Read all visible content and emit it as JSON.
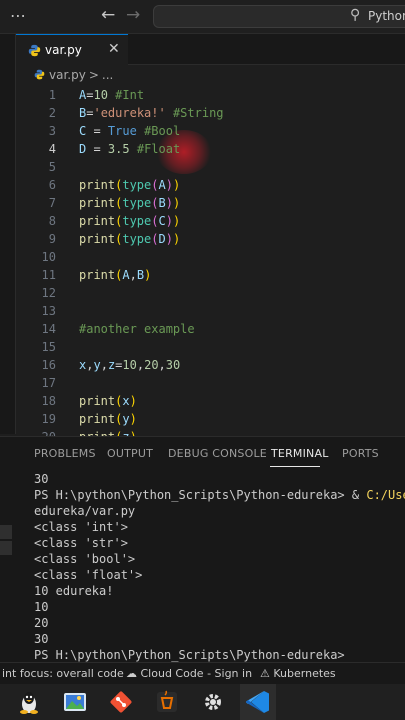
{
  "titlebar": {
    "search_text": "Python"
  },
  "tab": {
    "name": "var.py",
    "close": "✕"
  },
  "breadcrumb": {
    "file": "var.py",
    "sep": ">",
    "more": "..."
  },
  "editor": {
    "lines": [
      {
        "num": "1",
        "tokens": [
          [
            "v",
            "A"
          ],
          [
            "",
            "="
          ],
          [
            "n",
            "10"
          ],
          [
            "",
            " "
          ],
          [
            "c",
            "#Int"
          ]
        ]
      },
      {
        "num": "2",
        "tokens": [
          [
            "v",
            "B"
          ],
          [
            "",
            "="
          ],
          [
            "s",
            "'edureka!'"
          ],
          [
            "",
            " "
          ],
          [
            "c",
            "#String"
          ]
        ]
      },
      {
        "num": "3",
        "tokens": [
          [
            "v",
            "C"
          ],
          [
            "",
            " = "
          ],
          [
            "k",
            "True"
          ],
          [
            "",
            " "
          ],
          [
            "c",
            "#Bool"
          ]
        ]
      },
      {
        "num": "4",
        "tokens": [
          [
            "v",
            "D"
          ],
          [
            "",
            " = "
          ],
          [
            "n",
            "3.5"
          ],
          [
            "",
            " "
          ],
          [
            "c",
            "#Float"
          ]
        ]
      },
      {
        "num": "5",
        "tokens": []
      },
      {
        "num": "6",
        "tokens": [
          [
            "f",
            "print"
          ],
          [
            "p",
            "("
          ],
          [
            "t",
            "type"
          ],
          [
            "p2",
            "("
          ],
          [
            "v",
            "A"
          ],
          [
            "p2",
            ")"
          ],
          [
            "p",
            ")"
          ]
        ]
      },
      {
        "num": "7",
        "tokens": [
          [
            "f",
            "print"
          ],
          [
            "p",
            "("
          ],
          [
            "t",
            "type"
          ],
          [
            "p2",
            "("
          ],
          [
            "v",
            "B"
          ],
          [
            "p2",
            ")"
          ],
          [
            "p",
            ")"
          ]
        ]
      },
      {
        "num": "8",
        "tokens": [
          [
            "f",
            "print"
          ],
          [
            "p",
            "("
          ],
          [
            "t",
            "type"
          ],
          [
            "p2",
            "("
          ],
          [
            "v",
            "C"
          ],
          [
            "p2",
            ")"
          ],
          [
            "p",
            ")"
          ]
        ]
      },
      {
        "num": "9",
        "tokens": [
          [
            "f",
            "print"
          ],
          [
            "p",
            "("
          ],
          [
            "t",
            "type"
          ],
          [
            "p2",
            "("
          ],
          [
            "v",
            "D"
          ],
          [
            "p2",
            ")"
          ],
          [
            "p",
            ")"
          ]
        ]
      },
      {
        "num": "10",
        "tokens": []
      },
      {
        "num": "11",
        "tokens": [
          [
            "f",
            "print"
          ],
          [
            "p",
            "("
          ],
          [
            "v",
            "A"
          ],
          [
            "",
            ","
          ],
          [
            "v",
            "B"
          ],
          [
            "p",
            ")"
          ]
        ]
      },
      {
        "num": "12",
        "tokens": []
      },
      {
        "num": "13",
        "tokens": []
      },
      {
        "num": "14",
        "tokens": [
          [
            "c",
            "#another example"
          ]
        ]
      },
      {
        "num": "15",
        "tokens": []
      },
      {
        "num": "16",
        "tokens": [
          [
            "v",
            "x"
          ],
          [
            "",
            ","
          ],
          [
            "v",
            "y"
          ],
          [
            "",
            ","
          ],
          [
            "v",
            "z"
          ],
          [
            "",
            "="
          ],
          [
            "n",
            "10"
          ],
          [
            "",
            ","
          ],
          [
            "n",
            "20"
          ],
          [
            "",
            ","
          ],
          [
            "n",
            "30"
          ]
        ]
      },
      {
        "num": "17",
        "tokens": []
      },
      {
        "num": "18",
        "tokens": [
          [
            "f",
            "print"
          ],
          [
            "p",
            "("
          ],
          [
            "v",
            "x"
          ],
          [
            "p",
            ")"
          ]
        ]
      },
      {
        "num": "19",
        "tokens": [
          [
            "f",
            "print"
          ],
          [
            "p",
            "("
          ],
          [
            "v",
            "y"
          ],
          [
            "p",
            ")"
          ]
        ]
      },
      {
        "num": "20",
        "tokens": [
          [
            "f",
            "print"
          ],
          [
            "p",
            "("
          ],
          [
            "v",
            "z"
          ],
          [
            "p",
            ")"
          ]
        ]
      }
    ],
    "active_line": "4"
  },
  "panel": {
    "tabs": [
      "PROBLEMS",
      "OUTPUT",
      "DEBUG CONSOLE",
      "TERMINAL",
      "PORTS"
    ],
    "active_tab": "TERMINAL",
    "terminal": {
      "lines": [
        {
          "text": "30"
        },
        {
          "text": "PS H:\\python\\Python_Scripts\\Python-edureka> & ",
          "hl": "C:/Users/WD"
        },
        {
          "text": "edureka/var.py"
        },
        {
          "text": "<class 'int'>"
        },
        {
          "text": "<class 'str'>"
        },
        {
          "text": "<class 'bool'>"
        },
        {
          "text": "<class 'float'>"
        },
        {
          "text": "10 edureka!"
        },
        {
          "text": "10"
        },
        {
          "text": "20"
        },
        {
          "text": "30"
        },
        {
          "text": "PS H:\\python\\Python_Scripts\\Python-edureka>"
        }
      ]
    }
  },
  "statusbar": {
    "lint": "int focus: overall code",
    "cloud": "Cloud Code - Sign in",
    "kube": "Kubernetes"
  },
  "taskbar": {
    "apps": [
      "linux-icon",
      "image-viewer-icon",
      "git-icon",
      "java-icon",
      "settings-icon",
      "vscode-icon"
    ],
    "active": "vscode-icon"
  }
}
